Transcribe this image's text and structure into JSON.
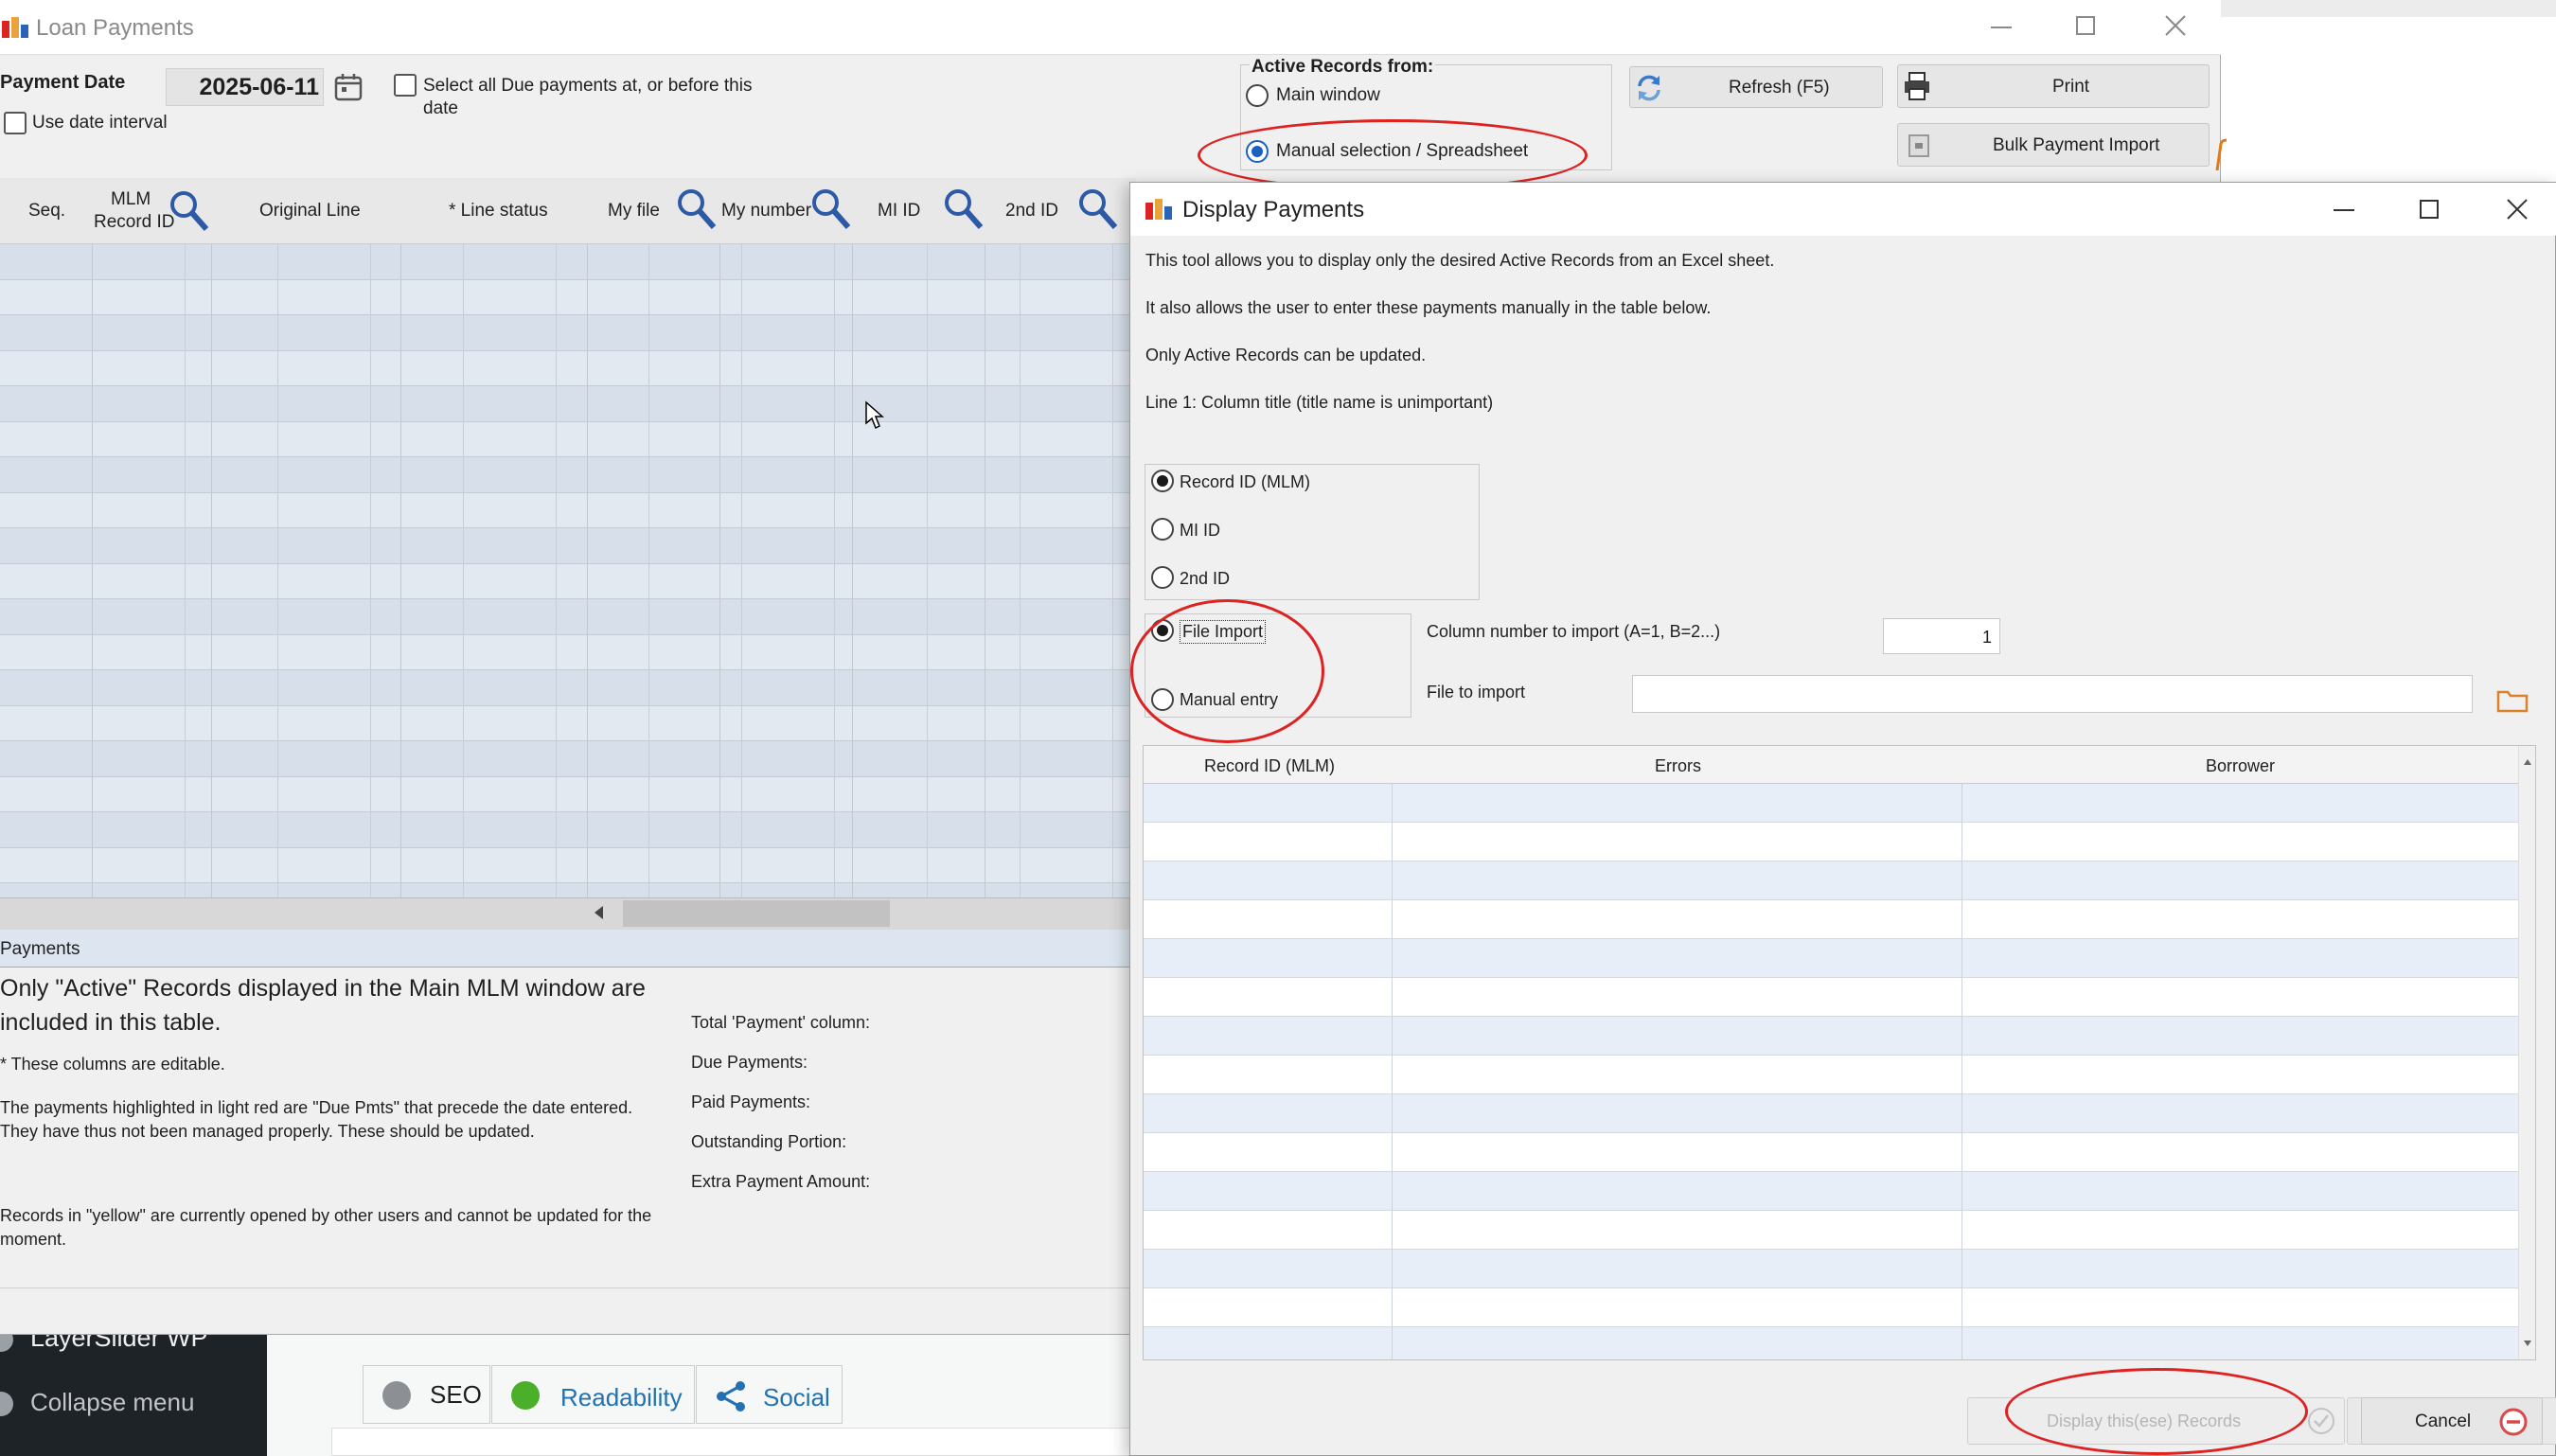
{
  "main": {
    "title": "Loan Payments",
    "payment_date_label": "Payment Date",
    "payment_date": "2025-06-11",
    "use_date_interval": "Use date interval",
    "select_all_due_line1": "Select all Due payments at, or before this",
    "select_all_due_line2": "date",
    "active_records_label": "Active Records from:",
    "main_window": "Main window",
    "manual_selection": "Manual selection / Spreadsheet",
    "refresh": "Refresh (F5)",
    "print": "Print",
    "bulk_import": "Bulk Payment Import",
    "columns": {
      "seq": "Seq.",
      "mlm_line1": "MLM",
      "mlm_line2": "Record ID",
      "original_line": "Original Line",
      "line_status": "* Line status",
      "my_file": "My file",
      "my_number": "My number",
      "mi_id": "MI ID",
      "second_id": "2nd ID"
    },
    "payments_label": "Payments",
    "info_main_line1": "Only \"Active\" Records displayed in the Main MLM window are",
    "info_main_line2": "included in this table.",
    "editable_note": "* These columns are editable.",
    "red_note_line1": "The payments highlighted in light red are \"Due Pmts\" that precede the date entered.",
    "red_note_line2": "They have thus not been managed properly. These should be updated.",
    "yellow_note_line1": "Records in \"yellow\" are currently opened by other users and cannot be updated for the",
    "yellow_note_line2": "moment.",
    "totals": {
      "total_payment": "Total 'Payment' column:",
      "due": "Due Payments:",
      "paid": "Paid Payments:",
      "outstanding": "Outstanding Portion:",
      "extra": "Extra Payment Amount:"
    }
  },
  "dialog": {
    "title": "Display Payments",
    "desc1": "This tool allows you to display only the desired Active Records from an Excel sheet.",
    "desc2": "It also allows  the user to enter these payments manually in the table below.",
    "desc3": "Only Active Records can be updated.",
    "desc4": "Line 1: Column title (title name is unimportant)",
    "id_options": [
      "Record ID (MLM)",
      "MI ID",
      "2nd ID"
    ],
    "selected_id": 0,
    "file_import": "File Import",
    "manual_entry": "Manual entry",
    "column_number_label": "Column number to import (A=1, B=2...)",
    "column_number_value": "1",
    "file_to_import_label": "File to import",
    "file_to_import_value": "",
    "table_headers": [
      "Record ID (MLM)",
      "Errors",
      "Borrower"
    ],
    "display_button": "Display this(ese) Records",
    "cancel_button": "Cancel"
  },
  "background": {
    "layerslider": "LayerSlider WP",
    "collapse_menu": "Collapse menu",
    "tab_seo": "SEO",
    "tab_readability": "Readability",
    "tab_social": "Social"
  },
  "colors": {
    "annotation_red": "#d22222",
    "row_blue": "#dde6f0",
    "folder_orange": "#d9822b",
    "readability_green": "#4caf2a",
    "admin_dark": "#1d2327"
  }
}
